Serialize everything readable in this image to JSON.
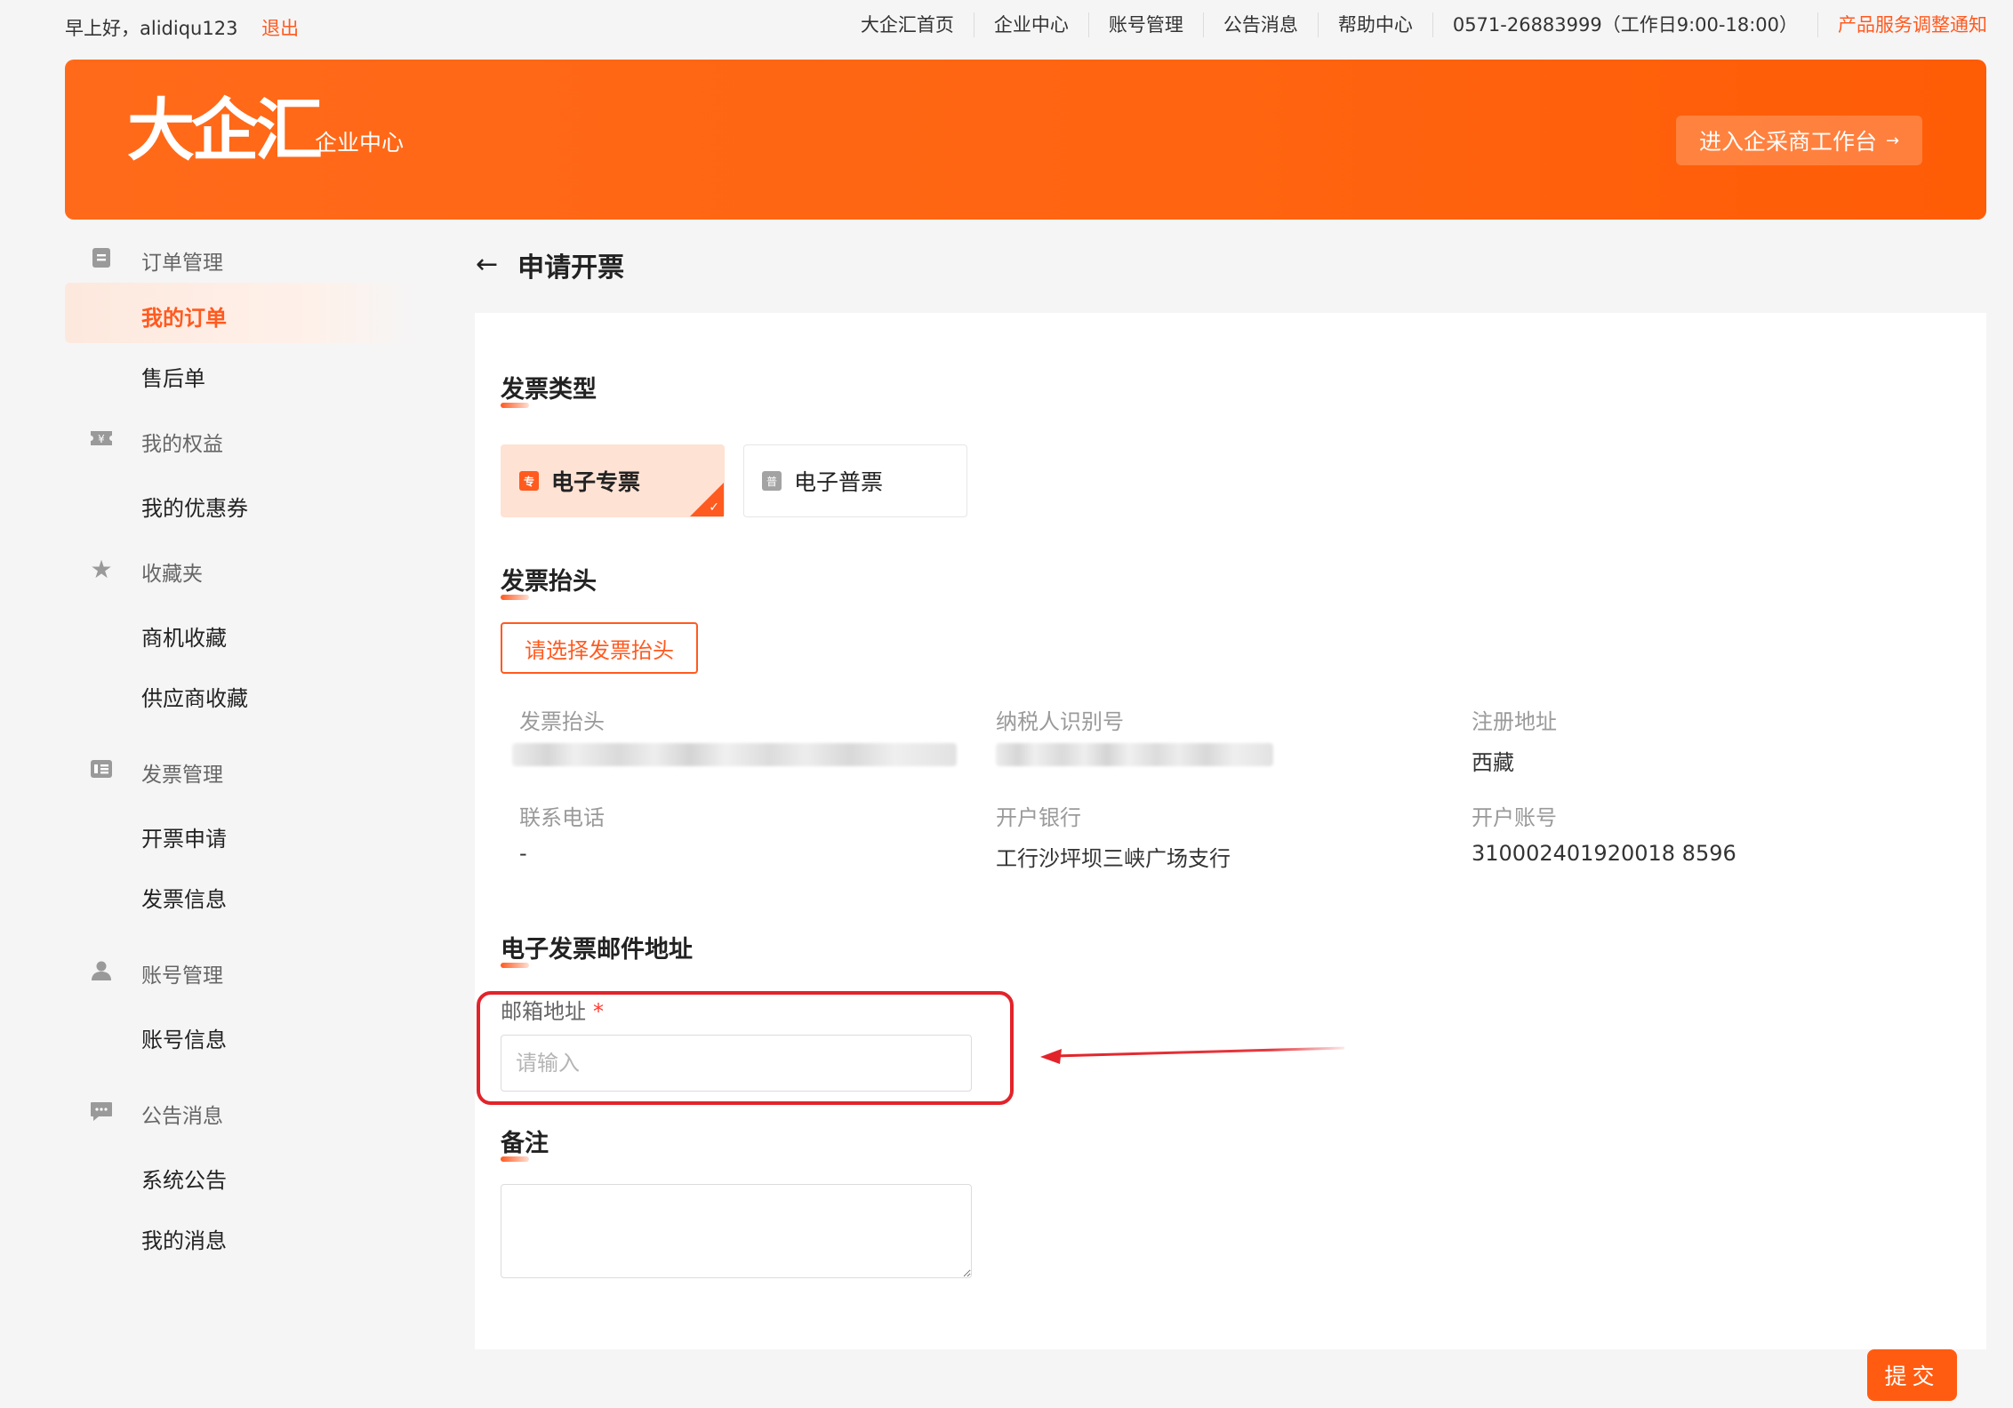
{
  "topbar": {
    "greeting": "早上好，alidiqu123",
    "logout": "退出",
    "nav": [
      "大企汇首页",
      "企业中心",
      "账号管理",
      "公告消息",
      "帮助中心",
      "0571-26883999（工作日9:00-18:00）"
    ],
    "notice": "产品服务调整通知"
  },
  "banner": {
    "logo": "大企汇",
    "subtitle": "企业中心",
    "workbench_btn": "进入企采商工作台",
    "workbench_arrow": "→"
  },
  "sidebar": {
    "groups": [
      {
        "icon": "document-icon",
        "label": "订单管理",
        "items": [
          "我的订单",
          "售后单"
        ]
      },
      {
        "icon": "coupon-icon",
        "label": "我的权益",
        "items": [
          "我的优惠券"
        ]
      },
      {
        "icon": "star-icon",
        "label": "收藏夹",
        "items": [
          "商机收藏",
          "供应商收藏"
        ]
      },
      {
        "icon": "invoice-icon",
        "label": "发票管理",
        "items": [
          "开票申请",
          "发票信息"
        ]
      },
      {
        "icon": "user-icon",
        "label": "账号管理",
        "items": [
          "账号信息"
        ]
      },
      {
        "icon": "message-icon",
        "label": "公告消息",
        "items": [
          "系统公告",
          "我的消息"
        ]
      }
    ],
    "active_item": "我的订单",
    "coupon_glyph": "¥",
    "star_glyph": "★"
  },
  "page": {
    "back": "←",
    "title": "申请开票"
  },
  "invoice_type": {
    "title": "发票类型",
    "options": [
      {
        "badge": "专",
        "label": "电子专票",
        "selected": true
      },
      {
        "badge": "普",
        "label": "电子普票",
        "selected": false
      }
    ],
    "check": "✓"
  },
  "invoice_header": {
    "title": "发票抬头",
    "choose_btn": "请选择发票抬头",
    "fields": [
      {
        "label": "发票抬头",
        "value": ""
      },
      {
        "label": "纳税人识别号",
        "value": ""
      },
      {
        "label": "注册地址",
        "value": "西藏"
      },
      {
        "label": "联系电话",
        "value": "-"
      },
      {
        "label": "开户银行",
        "value": "工行沙坪坝三峡广场支行"
      },
      {
        "label": "开户账号",
        "value": "310002401920018 8596"
      }
    ]
  },
  "email": {
    "title": "电子发票邮件地址",
    "label": "邮箱地址",
    "required_mark": "*",
    "placeholder": "请输入",
    "value": ""
  },
  "remark": {
    "title": "备注",
    "value": ""
  },
  "submit": "提交",
  "colors": {
    "accent": "#ff5a1f",
    "highlight": "#e2232a"
  }
}
